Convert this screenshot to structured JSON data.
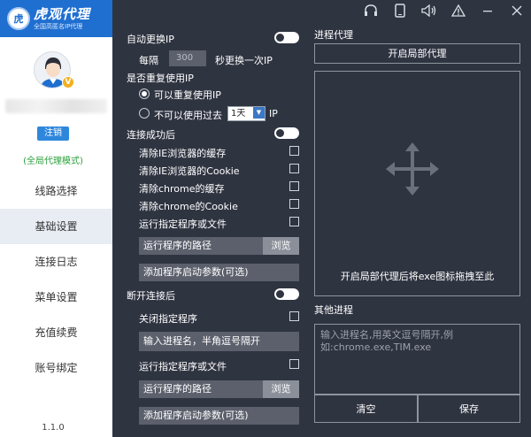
{
  "app": {
    "logo_badge": "虎",
    "title": "虎观代理",
    "subtitle": "全国高匿名IP代理"
  },
  "user": {
    "vip_badge": "V",
    "logout_label": "注销",
    "mode": "(全局代理模式)"
  },
  "nav": {
    "items": [
      {
        "label": "线路选择"
      },
      {
        "label": "基础设置"
      },
      {
        "label": "连接日志"
      },
      {
        "label": "菜单设置"
      },
      {
        "label": "充值续费"
      },
      {
        "label": "账号绑定"
      }
    ],
    "active_index": 1
  },
  "version": "1.1.0",
  "top_icons": [
    "headset-icon",
    "phone-icon",
    "speaker-icon",
    "warning-icon",
    "minimize-icon",
    "close-icon"
  ],
  "settings": {
    "auto_switch_label": "自动更换IP",
    "every_label": "每隔",
    "interval_value": "300",
    "interval_suffix": "秒更换一次IP",
    "reuse_label": "是否重复使用IP",
    "reuse_yes": "可以重复使用IP",
    "reuse_no_prefix": "不可以使用过去",
    "reuse_period": "1天",
    "reuse_no_suffix": "IP",
    "after_connect_label": "连接成功后",
    "after_connect_items": [
      "清除IE浏览器的缓存",
      "清除IE浏览器的Cookie",
      "清除chrome的缓存",
      "清除chrome的Cookie",
      "运行指定程序或文件"
    ],
    "program_path_placeholder": "运行程序的路径",
    "browse_label": "浏览",
    "program_args_placeholder": "添加程序启动参数(可选)",
    "after_disconnect_label": "断开连接后",
    "close_program_label": "关闭指定程序",
    "program_names_placeholder": "输入进程名，半角逗号隔开",
    "run_program_label": "运行指定程序或文件",
    "program_path_placeholder2": "运行程序的路径",
    "browse_label2": "浏览",
    "program_args_placeholder2": "添加程序启动参数(可选)"
  },
  "process_proxy": {
    "title": "进程代理",
    "enable_button": "开启局部代理",
    "drop_hint": "开启局部代理后将exe图标拖拽至此",
    "other_title": "其他进程",
    "other_placeholder_line1": "输入进程名,用英文逗号隔开,例",
    "other_placeholder_line2": "如:chrome.exe,TIM.exe",
    "clear_button": "清空",
    "save_button": "保存"
  },
  "colors": {
    "background": "#2f3441",
    "brand": "#1f6fd1",
    "field": "#5b606c",
    "success_text": "#2aa03a"
  }
}
